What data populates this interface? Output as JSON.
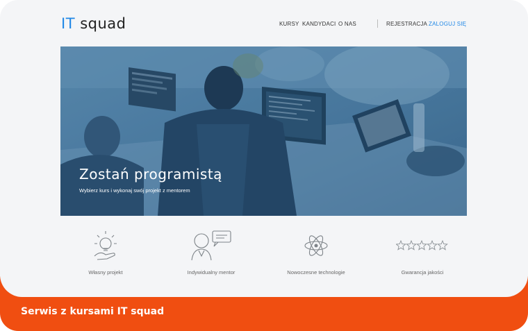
{
  "app": {
    "logo_prefix": "IT",
    "logo_suffix": "squad"
  },
  "nav": {
    "items": [
      "KURSY",
      "KANDYDACI",
      "O NAS"
    ],
    "register": "REJESTRACJA",
    "login": "ZALOGUJ SIĘ",
    "accent_color": "#1f87e6"
  },
  "hero": {
    "title": "Zostań programistą",
    "subtitle": "Wybierz kurs i wykonaj swój projekt z mentorem"
  },
  "features": [
    {
      "icon": "lightbulb-hand-icon",
      "label": "Własny projekt"
    },
    {
      "icon": "mentor-chat-icon",
      "label": "Indywidualny mentor"
    },
    {
      "icon": "atom-icon",
      "label": "Nowoczesne technologie"
    },
    {
      "icon": "five-stars-icon",
      "label": "Gwarancja jakości"
    }
  ],
  "caption": {
    "text": "Serwis z kursami IT squad",
    "color": "#f04e11"
  }
}
